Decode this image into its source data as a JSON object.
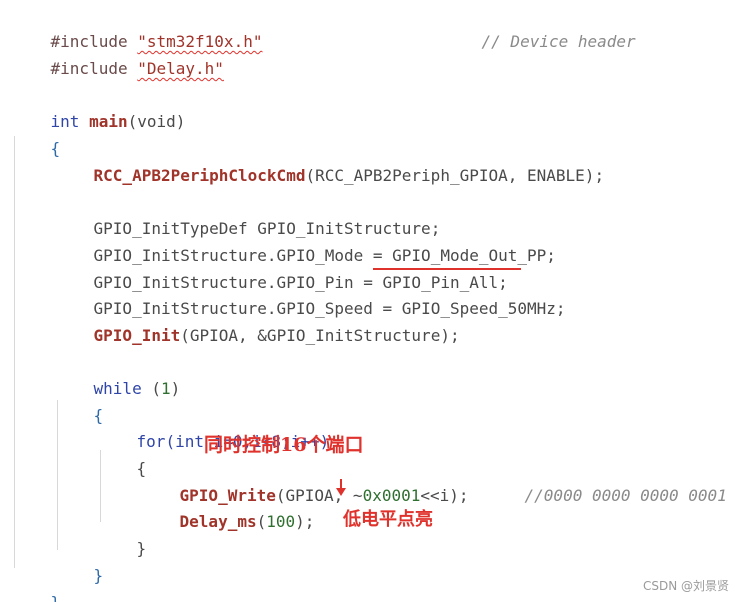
{
  "code": {
    "line1": {
      "include": "#include",
      "file": "\"stm32f10x.h\"",
      "comment": "// Device header"
    },
    "line2": {
      "include": "#include",
      "file": "\"Delay.h\""
    },
    "line4": {
      "type": "int",
      "name": "main",
      "params": "(void)"
    },
    "line5": {
      "brace": "{"
    },
    "line6": {
      "fn": "RCC_APB2PeriphClockCmd",
      "args": "(RCC_APB2Periph_GPIOA, ENABLE);"
    },
    "line8": {
      "type": "GPIO_InitTypeDef",
      "var": "GPIO_InitStructure;"
    },
    "line9": {
      "lhs": "GPIO_InitStructure.GPIO_Mode",
      "op": " = ",
      "rhs": "GPIO_Mode_Out_PP;"
    },
    "line10": {
      "lhs": "GPIO_InitStructure.GPIO_Pin",
      "op": " = ",
      "rhs": "GPIO_Pin_All;"
    },
    "line11": {
      "lhs": "GPIO_InitStructure.GPIO_Speed",
      "op": " = ",
      "rhs": "GPIO_Speed_50MHz;"
    },
    "line12": {
      "fn": "GPIO_Init",
      "args": "(GPIOA, &GPIO_InitStructure);"
    },
    "line14": {
      "kw": "while",
      "open": " (",
      "num": "1",
      "close": ")"
    },
    "line15": {
      "brace": "{"
    },
    "line16": {
      "kw": "for",
      "body": "(int i=0;i<8;i++)"
    },
    "line17": {
      "brace": "{"
    },
    "line18": {
      "fn": "GPIO_Write",
      "args": "(GPIOA, ",
      "tilde": "~",
      "hex": "0x0001",
      "rest": "<<i);",
      "comment": "//0000 0000 0000 0001"
    },
    "line19": {
      "fn": "Delay_ms",
      "open": "(",
      "num": "100",
      "close": ");"
    },
    "line20": {
      "brace": "}"
    },
    "line21": {
      "brace": "}"
    },
    "line22": {
      "brace": "}"
    }
  },
  "annotations": {
    "control_ports": "同时控制16个端口",
    "low_level_on": "低电平点亮"
  },
  "watermark": "CSDN @刘景贤",
  "colors": {
    "keyword": "#2f45a8",
    "function": "#a0342a",
    "comment": "#8a8a8a",
    "annotation": "#e0322c"
  }
}
